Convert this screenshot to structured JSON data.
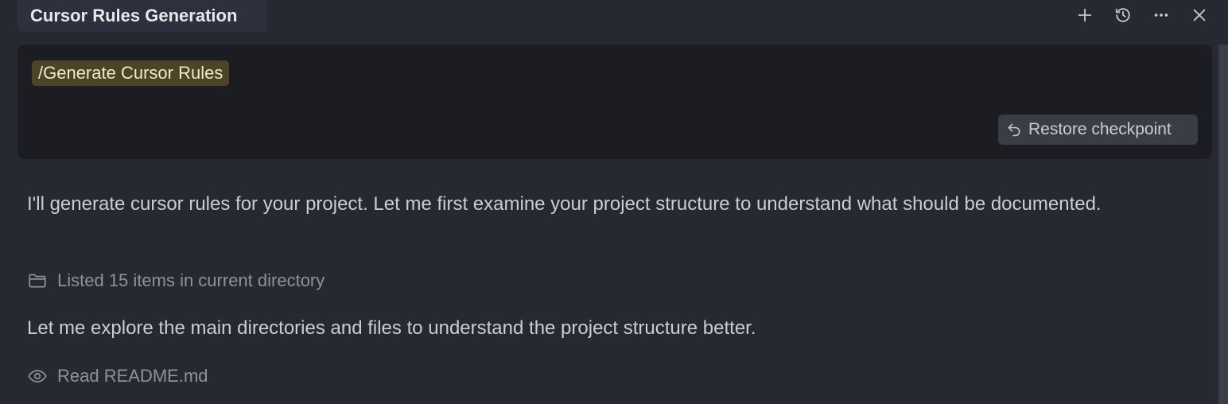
{
  "header": {
    "title": "Cursor Rules Generation",
    "icons": [
      "plus-icon",
      "history-icon",
      "more-icon",
      "close-icon"
    ]
  },
  "message": {
    "command": "/Generate Cursor Rules",
    "restore_label": "Restore checkpoint"
  },
  "assistant": {
    "paragraph_1": "I'll generate cursor rules for your project. Let me first examine your project structure to understand what should be documented.",
    "tool_1": {
      "icon": "folder-icon",
      "label": "Listed 15 items in current directory"
    },
    "paragraph_2": "Let me explore the main directories and files to understand the project structure better.",
    "tool_2": {
      "icon": "eye-icon",
      "label": "Read README.md"
    }
  },
  "colors": {
    "background": "#262932",
    "card": "#1c1d22",
    "command_chip": "#4b4427"
  }
}
